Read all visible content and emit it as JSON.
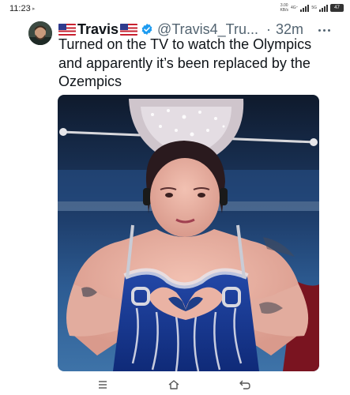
{
  "status_bar": {
    "time": "11:23",
    "indicator": "▸",
    "net_speed_1": "3.00",
    "net_unit_1": "KB/s",
    "net_speed_2": "4G⁺",
    "net_speed_3": "5G",
    "battery": "47"
  },
  "tweet": {
    "display_name": "Travis",
    "handle": "@Travis4_Tru...",
    "separator": "·",
    "time": "32m",
    "text": "Turned on the TV to watch the Olympics and apparently it’s been replaced by the Ozempics"
  },
  "icons": {
    "flag": "us-flag-icon",
    "verified": "verified-badge-icon",
    "more": "more-options-icon"
  },
  "navigation": {
    "recents": "recents-icon",
    "home": "home-icon",
    "back": "back-icon"
  },
  "colors": {
    "verified": "#1d9bf0",
    "secondary_text": "#536471",
    "primary_text": "#0f1419"
  }
}
